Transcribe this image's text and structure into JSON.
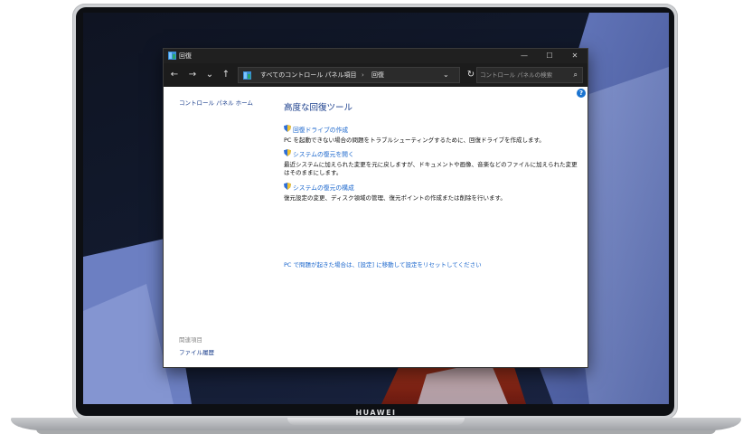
{
  "device": {
    "brand": "HUAWEI"
  },
  "window": {
    "title": "回復",
    "controls": {
      "minimize": "—",
      "maximize": "☐",
      "close": "✕"
    }
  },
  "navigation": {
    "back": "←",
    "forward": "→",
    "recent": "⌄",
    "up": "↑",
    "breadcrumb": [
      "すべてのコントロール パネル項目",
      "回復"
    ],
    "separator": "›",
    "dropdown": "⌄",
    "refresh": "↻",
    "search_placeholder": "コントロール パネルの検索",
    "search_icon": "⌕"
  },
  "sidebar": {
    "home_link": "コントロール パネル ホーム",
    "related_title": "関連項目",
    "related_items": [
      "ファイル履歴"
    ]
  },
  "main": {
    "help": "?",
    "title": "高度な回復ツール",
    "tools": [
      {
        "label": "回復ドライブの作成",
        "description": "PC を起動できない場合の問題をトラブルシューティングするために、回復ドライブを作成します。"
      },
      {
        "label": "システムの復元を開く",
        "description": "最近システムに加えられた変更を元に戻しますが、ドキュメントや画像、音楽などのファイルに加えられた変更はそのままにします。"
      },
      {
        "label": "システムの復元の構成",
        "description": "復元設定の変更、ディスク領域の管理、復元ポイントの作成または削除を行います。"
      }
    ],
    "reset_link": "PC で問題が起きた場合は、[設定] に移動して設定をリセットしてください"
  },
  "colors": {
    "link": "#1a66cc",
    "title": "#1a3e8c",
    "titlebar": "#202020",
    "wallpaper_accent": "#5a6fb8"
  }
}
